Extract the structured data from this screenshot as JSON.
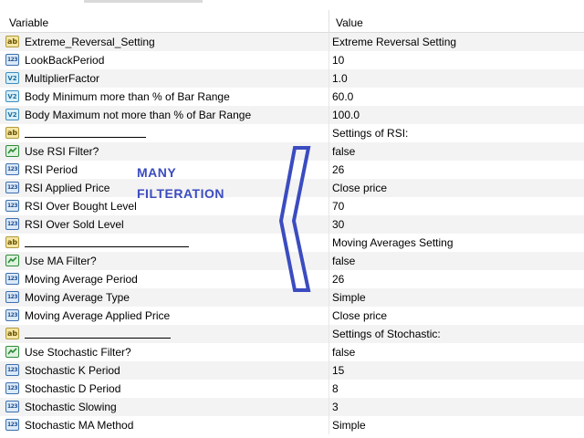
{
  "header": {
    "variable": "Variable",
    "value": "Value"
  },
  "rows": [
    {
      "icon": "ab-icon",
      "name": "Extreme_Reversal_Setting",
      "value": "Extreme Reversal Setting"
    },
    {
      "icon": "integer-icon",
      "name": "LookBackPeriod",
      "value": "10"
    },
    {
      "icon": "double-icon",
      "name": "MultiplierFactor",
      "value": "1.0"
    },
    {
      "icon": "double-icon",
      "name": "Body Minimum more than % of Bar Range",
      "value": "60.0"
    },
    {
      "icon": "double-icon",
      "name": "Body Maximum not more than % of Bar Range",
      "value": "100.0"
    },
    {
      "icon": "ab-icon",
      "name": "____________________",
      "value": "Settings of RSI:"
    },
    {
      "icon": "bool-icon",
      "name": "Use RSI Filter?",
      "value": "false"
    },
    {
      "icon": "integer-icon",
      "name": "RSI Period",
      "value": "26"
    },
    {
      "icon": "integer-icon",
      "name": "RSI Applied Price",
      "value": "Close price"
    },
    {
      "icon": "integer-icon",
      "name": "RSI Over Bought Level",
      "value": "70"
    },
    {
      "icon": "integer-icon",
      "name": "RSI Over Sold Level",
      "value": "30"
    },
    {
      "icon": "ab-icon",
      "name": "___________________________",
      "value": "Moving Averages Setting"
    },
    {
      "icon": "bool-icon",
      "name": "Use MA Filter?",
      "value": "false"
    },
    {
      "icon": "integer-icon",
      "name": "Moving Average Period",
      "value": "26"
    },
    {
      "icon": "integer-icon",
      "name": "Moving Average Type",
      "value": "Simple"
    },
    {
      "icon": "integer-icon",
      "name": "Moving Average Applied Price",
      "value": "Close price"
    },
    {
      "icon": "ab-icon",
      "name": "________________________",
      "value": "Settings of Stochastic:"
    },
    {
      "icon": "bool-icon",
      "name": "Use Stochastic Filter?",
      "value": "false"
    },
    {
      "icon": "integer-icon",
      "name": "Stochastic K Period",
      "value": "15"
    },
    {
      "icon": "integer-icon",
      "name": "Stochastic D Period",
      "value": "8"
    },
    {
      "icon": "integer-icon",
      "name": "Stochastic Slowing",
      "value": "3"
    },
    {
      "icon": "integer-icon",
      "name": "Stochastic MA Method",
      "value": "Simple"
    }
  ],
  "icon_text": {
    "ab": "ab",
    "integer": "123",
    "double": "V2"
  },
  "annotation": {
    "line1": "MANY",
    "line2": "FILTERATION",
    "color": "#3b4cc0"
  }
}
